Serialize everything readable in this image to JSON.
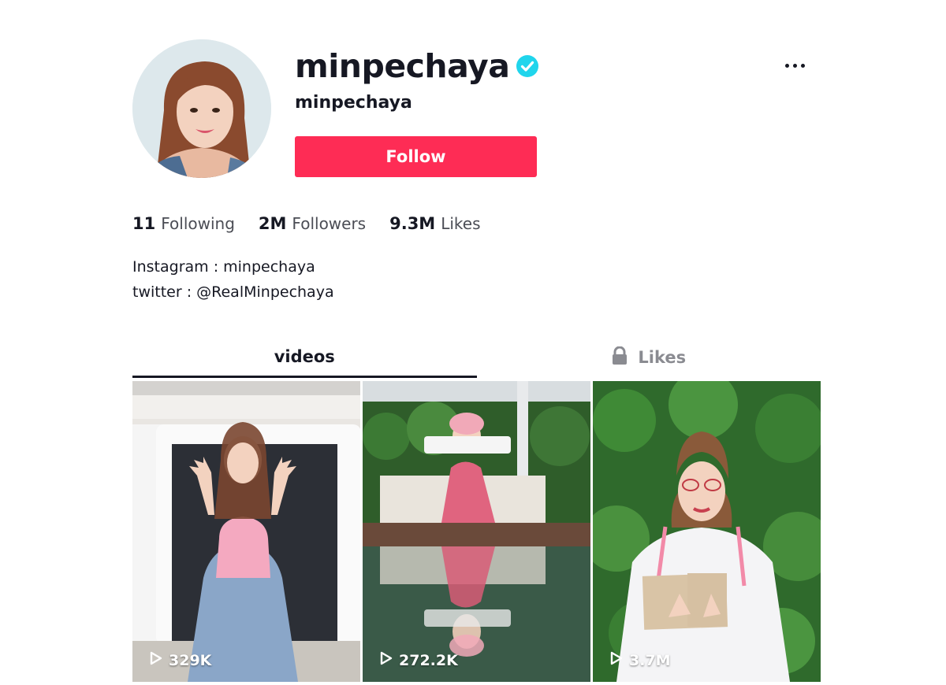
{
  "profile": {
    "username": "minpechaya",
    "nickname": "minpechaya",
    "verified": true,
    "follow_label": "Follow",
    "avatar_icon": "profile-photo"
  },
  "stats": {
    "following": {
      "count": "11",
      "label": "Following"
    },
    "followers": {
      "count": "2M",
      "label": "Followers"
    },
    "likes": {
      "count": "9.3M",
      "label": "Likes"
    }
  },
  "bio": {
    "line1": "Instagram : minpechaya",
    "line2": "twitter : @RealMinpechaya"
  },
  "tabs": {
    "videos": "videos",
    "likes": "Likes"
  },
  "videos": [
    {
      "views": "329K"
    },
    {
      "views": "272.2K"
    },
    {
      "views": "3.7M"
    }
  ],
  "colors": {
    "accent": "#fe2c55",
    "verified": "#20d5ec",
    "text": "#161823",
    "muted": "#8a8b91"
  }
}
